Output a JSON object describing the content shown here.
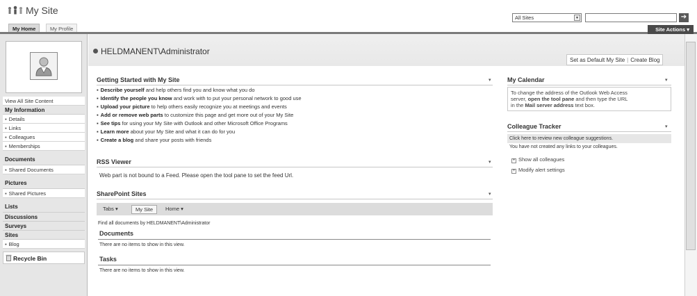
{
  "header": {
    "site_title": "My Site",
    "tabs": [
      "My Home",
      "My Profile"
    ],
    "search_scope": "All Sites",
    "search_value": "",
    "site_actions_label": "Site Actions"
  },
  "left_nav": {
    "view_all": "View All Site Content",
    "sections": [
      {
        "title": "My Information",
        "items": [
          "Details",
          "Links",
          "Colleagues",
          "Memberships"
        ]
      },
      {
        "title": "Documents",
        "items": [
          "Shared Documents"
        ]
      },
      {
        "title": "Pictures",
        "items": [
          "Shared Pictures"
        ]
      },
      {
        "title": "Lists",
        "items": []
      },
      {
        "title": "Discussions",
        "items": []
      },
      {
        "title": "Surveys",
        "items": []
      },
      {
        "title": "Sites",
        "items": [
          "Blog"
        ]
      }
    ],
    "recycle_bin": "Recycle Bin"
  },
  "page": {
    "user_title": "HELDMANENT\\Administrator",
    "link_default": "Set as Default My Site",
    "link_separator": "|",
    "link_blog": "Create Blog"
  },
  "getting_started": {
    "title": "Getting Started with My Site",
    "items": [
      {
        "bold": "Describe yourself",
        "rest": " and help others find you and know what you do"
      },
      {
        "bold": "Identify the people you know",
        "rest": " and work with to put your personal network to good use"
      },
      {
        "bold": "Upload your picture",
        "rest": " to help others easily recognize you at meetings and events"
      },
      {
        "bold": "Add or remove web parts",
        "rest": " to customize this page and get more out of your My Site"
      },
      {
        "bold": "See tips",
        "rest": " for using your My Site with Outlook and other Microsoft Office Programs"
      },
      {
        "bold": "Learn more",
        "rest": " about your My Site and what it can do for you"
      },
      {
        "bold": "Create a blog",
        "rest": " and share your posts with friends"
      }
    ]
  },
  "rss_viewer": {
    "title": "RSS Viewer",
    "message": "Web part is not bound to a Feed. Please open the tool pane to set the feed Url."
  },
  "sharepoint_sites": {
    "title": "SharePoint Sites",
    "tabs": [
      "Tabs",
      "My Site",
      "Home"
    ],
    "find_text": "Find all documents by HELDMANENT\\Administrator",
    "documents_title": "Documents",
    "documents_empty": "There are no items to show in this view.",
    "tasks_title": "Tasks",
    "tasks_empty": "There are no items to show in this view."
  },
  "calendar": {
    "title": "My Calendar",
    "text_1": "To change the address of the Outlook Web Access",
    "text_2a": "server, ",
    "text_2b": "open the tool pane",
    "text_2c": " and then type the URL",
    "text_3a": "in the ",
    "text_3b": "Mail server address",
    "text_3c": " text box."
  },
  "colleague_tracker": {
    "title": "Colleague Tracker",
    "review": "Click here to review new colleague suggestions.",
    "none": "You have not created any links to your colleagues.",
    "show_all": "Show all colleagues",
    "modify": "Modify alert settings"
  },
  "icons": {
    "menu_arrow": "▾",
    "dropdown": "▼",
    "go": "➔",
    "plus_box": "+"
  }
}
